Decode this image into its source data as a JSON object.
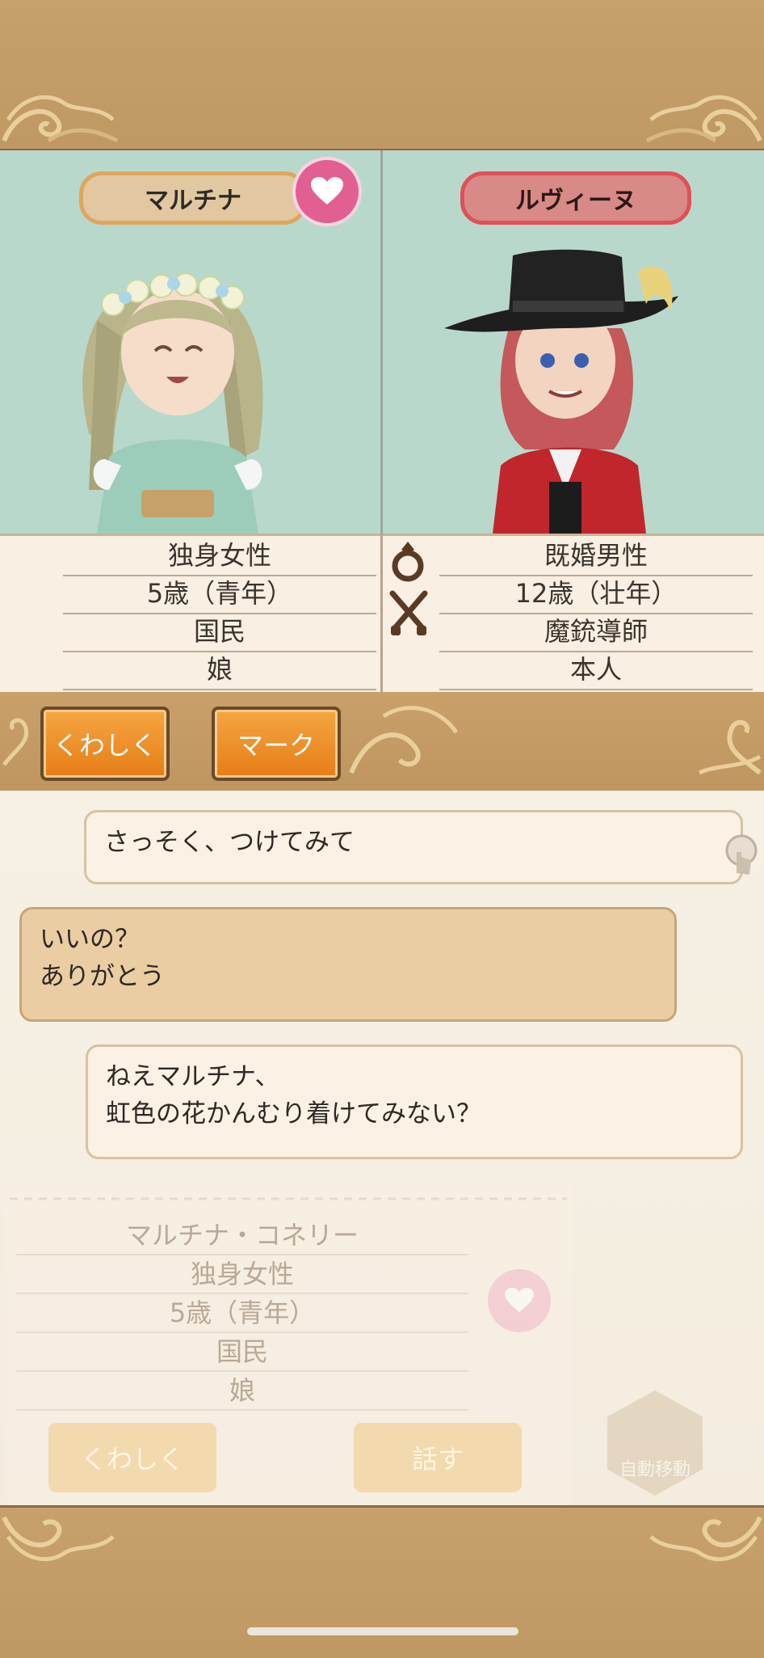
{
  "left_character": {
    "name": "マルチナ",
    "info": [
      "独身女性",
      "5歳（青年）",
      "国民",
      "娘"
    ]
  },
  "right_character": {
    "name": "ルヴィーヌ",
    "info": [
      "既婚男性",
      "12歳（壮年）",
      "魔銃導師",
      "本人"
    ]
  },
  "buttons": {
    "details": "くわしく",
    "mark": "マーク"
  },
  "chat": [
    {
      "text": "さっそく、つけてみて"
    },
    {
      "line1": "いいの？",
      "line2": "ありがとう"
    },
    {
      "line1": "ねえマルチナ、",
      "line2": "虹色の花かんむり着けてみない？"
    }
  ],
  "background_panel": {
    "full_name": "マルチナ・コネリー",
    "info": [
      "独身女性",
      "5歳（青年）",
      "国民",
      "娘"
    ],
    "details_label": "くわしく",
    "talk_label": "話す",
    "auto_move_label": "自動移動"
  },
  "colors": {
    "accent_pink": "#e25f92",
    "button_orange": "#e67d16",
    "frame_tan": "#c49c68",
    "portrait_bg": "#b9d8cc"
  }
}
